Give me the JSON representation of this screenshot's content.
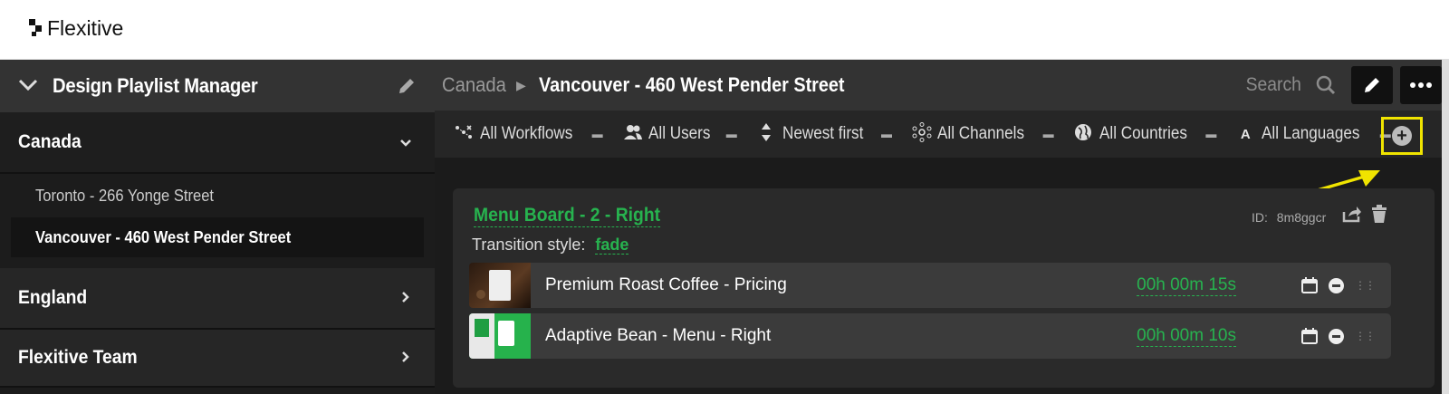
{
  "brand": {
    "name": "Flexitive"
  },
  "sidebar": {
    "title": "Design Playlist Manager",
    "sections": [
      {
        "label": "Canada",
        "expanded": true,
        "children": [
          "Toronto - 266 Yonge Street",
          "Vancouver - 460 West Pender Street"
        ],
        "active_child": "Vancouver - 460 West Pender Street"
      },
      {
        "label": "England",
        "expanded": false
      },
      {
        "label": "Flexitive Team",
        "expanded": false
      }
    ]
  },
  "header": {
    "breadcrumb": [
      "Canada",
      "Vancouver - 460 West Pender Street"
    ],
    "search_label": "Search"
  },
  "filters": [
    {
      "label": "All Workflows",
      "icon": "workflow-icon"
    },
    {
      "label": "All Users",
      "icon": "users-icon"
    },
    {
      "label": "Newest first",
      "icon": "sort-icon"
    },
    {
      "label": "All Channels",
      "icon": "channels-icon"
    },
    {
      "label": "All Countries",
      "icon": "globe-icon"
    },
    {
      "label": "All Languages",
      "icon": "language-icon"
    }
  ],
  "playlist": {
    "title": "Menu Board - 2 - Right",
    "transition_label": "Transition style:",
    "transition_value": "fade",
    "id_label": "ID:",
    "id_value": "8m8ggcr",
    "items": [
      {
        "name": "Premium Roast Coffee - Pricing",
        "duration": "00h 00m 15s"
      },
      {
        "name": "Adaptive Bean - Menu - Right",
        "duration": "00h 00m 10s"
      }
    ]
  },
  "colors": {
    "accent_green": "#27b34f",
    "highlight_yellow": "#f0e400"
  }
}
